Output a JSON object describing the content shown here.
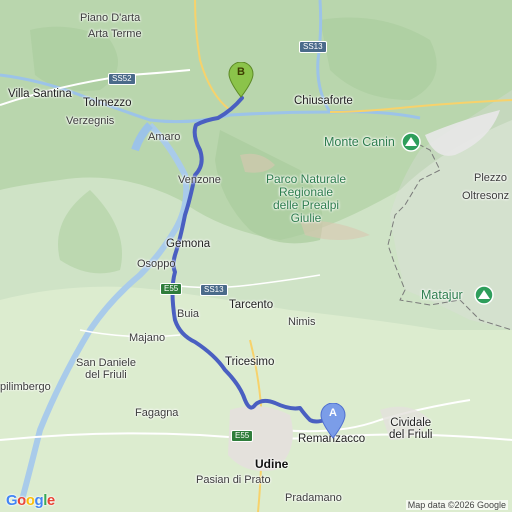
{
  "map": {
    "places": {
      "piano_darta": "Piano D'arta",
      "arta_terme": "Arta Terme",
      "villa_santina": "Villa Santina",
      "tolmezzo": "Tolmezzo",
      "verzegnis": "Verzegnis",
      "amaro": "Amaro",
      "chiusaforte": "Chiusaforte",
      "venzone": "Venzone",
      "gemona": "Gemona",
      "osoppo": "Osoppo",
      "tarcento": "Tarcento",
      "buia": "Buia",
      "nimis": "Nimis",
      "majano": "Majano",
      "san_daniele": "San Daniele\ndel Friuli",
      "tricesimo": "Tricesimo",
      "spilimbergo": "pilimbergo",
      "fagagna": "Fagagna",
      "remanzacco": "Remanzacco",
      "cividale": "Cividale\ndel Friuli",
      "udine": "Udine",
      "pasian": "Pasian di Prato",
      "pradamano": "Pradamano",
      "plezzo": "Plezzo",
      "oltresonz": "Oltresonz"
    },
    "park": "Parco Naturale\nRegionale\ndelle Prealpi\nGiulie",
    "peaks": {
      "monte_canin": "Monte Canin",
      "matajur": "Matajur"
    },
    "road_shields": {
      "ss13_north": "SS13",
      "ss52": "SS52",
      "e55_north": "E55",
      "ss13_south": "SS13",
      "e55_south": "E55"
    },
    "markers": {
      "start": "A",
      "end": "B"
    },
    "attribution": "Map data ©2026 Google",
    "logo": "Google",
    "colors": {
      "route": "#4a5fc1",
      "marker_a": "#7b9de8",
      "marker_b": "#8bc34a",
      "park_text": "#2e7d4e"
    }
  }
}
